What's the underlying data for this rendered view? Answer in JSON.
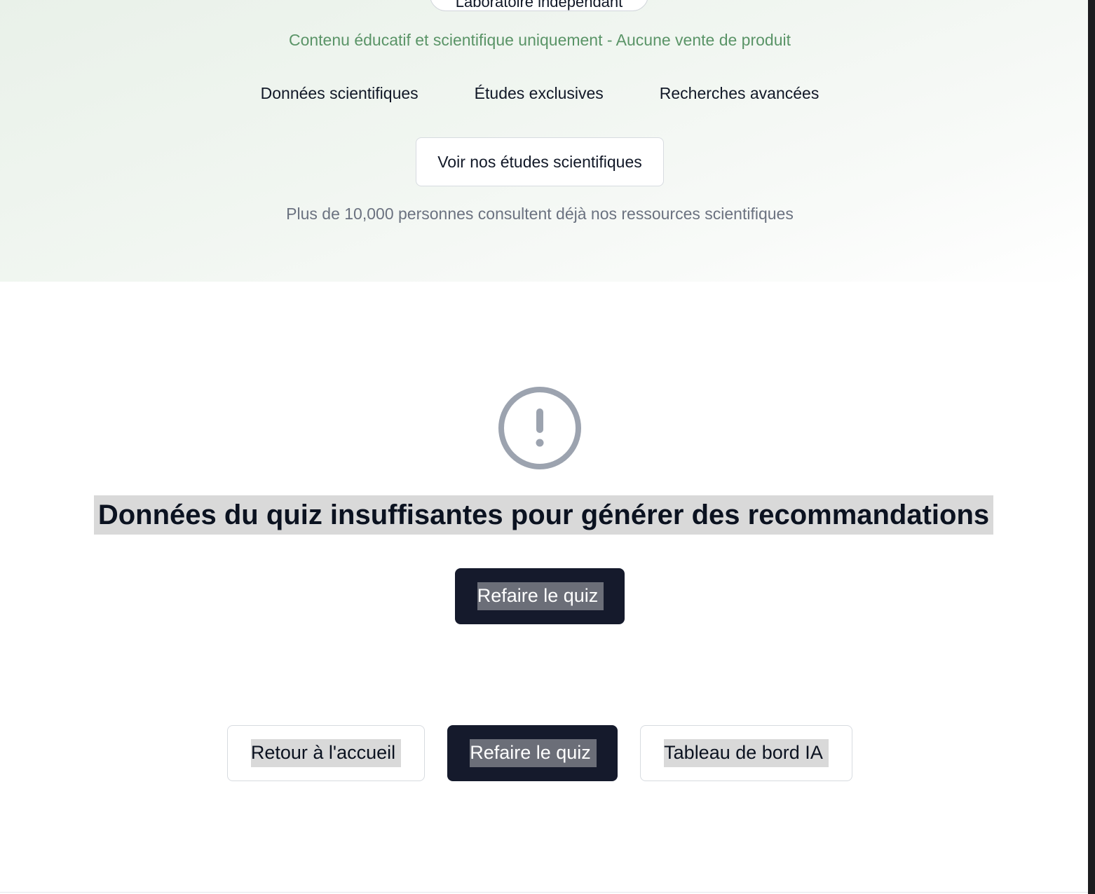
{
  "hero": {
    "badge_label": "Laboratoire indépendant",
    "disclaimer": "Contenu éducatif et scientifique uniquement - Aucune vente de produit",
    "features": [
      "Données scientifiques",
      "Études exclusives",
      "Recherches avancées"
    ],
    "studies_button": "Voir nos études scientifiques",
    "social_proof": "Plus de 10,000 personnes consultent déjà nos ressources scientifiques"
  },
  "result": {
    "icon": "alert-circle-icon",
    "message": "Données du quiz insuffisantes pour générer des recommandations",
    "retry_label": "Refaire le quiz"
  },
  "actions": {
    "home_label": "Retour à l'accueil",
    "retry_label": "Refaire le quiz",
    "dashboard_label": "Tableau de bord IA"
  },
  "colors": {
    "accent_green": "#5a9467",
    "dark_button": "#151a2c",
    "icon_gray": "#9ca3af"
  }
}
